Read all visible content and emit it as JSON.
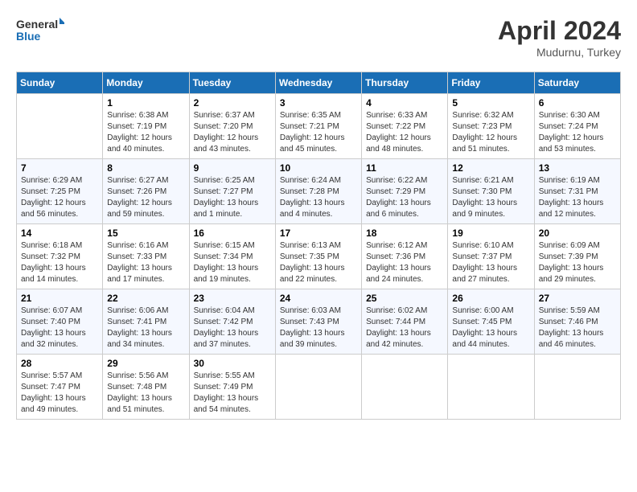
{
  "header": {
    "logo_line1": "General",
    "logo_line2": "Blue",
    "month": "April 2024",
    "location": "Mudurnu, Turkey"
  },
  "weekdays": [
    "Sunday",
    "Monday",
    "Tuesday",
    "Wednesday",
    "Thursday",
    "Friday",
    "Saturday"
  ],
  "weeks": [
    [
      {
        "day": "",
        "sunrise": "",
        "sunset": "",
        "daylight": ""
      },
      {
        "day": "1",
        "sunrise": "Sunrise: 6:38 AM",
        "sunset": "Sunset: 7:19 PM",
        "daylight": "Daylight: 12 hours and 40 minutes."
      },
      {
        "day": "2",
        "sunrise": "Sunrise: 6:37 AM",
        "sunset": "Sunset: 7:20 PM",
        "daylight": "Daylight: 12 hours and 43 minutes."
      },
      {
        "day": "3",
        "sunrise": "Sunrise: 6:35 AM",
        "sunset": "Sunset: 7:21 PM",
        "daylight": "Daylight: 12 hours and 45 minutes."
      },
      {
        "day": "4",
        "sunrise": "Sunrise: 6:33 AM",
        "sunset": "Sunset: 7:22 PM",
        "daylight": "Daylight: 12 hours and 48 minutes."
      },
      {
        "day": "5",
        "sunrise": "Sunrise: 6:32 AM",
        "sunset": "Sunset: 7:23 PM",
        "daylight": "Daylight: 12 hours and 51 minutes."
      },
      {
        "day": "6",
        "sunrise": "Sunrise: 6:30 AM",
        "sunset": "Sunset: 7:24 PM",
        "daylight": "Daylight: 12 hours and 53 minutes."
      }
    ],
    [
      {
        "day": "7",
        "sunrise": "Sunrise: 6:29 AM",
        "sunset": "Sunset: 7:25 PM",
        "daylight": "Daylight: 12 hours and 56 minutes."
      },
      {
        "day": "8",
        "sunrise": "Sunrise: 6:27 AM",
        "sunset": "Sunset: 7:26 PM",
        "daylight": "Daylight: 12 hours and 59 minutes."
      },
      {
        "day": "9",
        "sunrise": "Sunrise: 6:25 AM",
        "sunset": "Sunset: 7:27 PM",
        "daylight": "Daylight: 13 hours and 1 minute."
      },
      {
        "day": "10",
        "sunrise": "Sunrise: 6:24 AM",
        "sunset": "Sunset: 7:28 PM",
        "daylight": "Daylight: 13 hours and 4 minutes."
      },
      {
        "day": "11",
        "sunrise": "Sunrise: 6:22 AM",
        "sunset": "Sunset: 7:29 PM",
        "daylight": "Daylight: 13 hours and 6 minutes."
      },
      {
        "day": "12",
        "sunrise": "Sunrise: 6:21 AM",
        "sunset": "Sunset: 7:30 PM",
        "daylight": "Daylight: 13 hours and 9 minutes."
      },
      {
        "day": "13",
        "sunrise": "Sunrise: 6:19 AM",
        "sunset": "Sunset: 7:31 PM",
        "daylight": "Daylight: 13 hours and 12 minutes."
      }
    ],
    [
      {
        "day": "14",
        "sunrise": "Sunrise: 6:18 AM",
        "sunset": "Sunset: 7:32 PM",
        "daylight": "Daylight: 13 hours and 14 minutes."
      },
      {
        "day": "15",
        "sunrise": "Sunrise: 6:16 AM",
        "sunset": "Sunset: 7:33 PM",
        "daylight": "Daylight: 13 hours and 17 minutes."
      },
      {
        "day": "16",
        "sunrise": "Sunrise: 6:15 AM",
        "sunset": "Sunset: 7:34 PM",
        "daylight": "Daylight: 13 hours and 19 minutes."
      },
      {
        "day": "17",
        "sunrise": "Sunrise: 6:13 AM",
        "sunset": "Sunset: 7:35 PM",
        "daylight": "Daylight: 13 hours and 22 minutes."
      },
      {
        "day": "18",
        "sunrise": "Sunrise: 6:12 AM",
        "sunset": "Sunset: 7:36 PM",
        "daylight": "Daylight: 13 hours and 24 minutes."
      },
      {
        "day": "19",
        "sunrise": "Sunrise: 6:10 AM",
        "sunset": "Sunset: 7:37 PM",
        "daylight": "Daylight: 13 hours and 27 minutes."
      },
      {
        "day": "20",
        "sunrise": "Sunrise: 6:09 AM",
        "sunset": "Sunset: 7:39 PM",
        "daylight": "Daylight: 13 hours and 29 minutes."
      }
    ],
    [
      {
        "day": "21",
        "sunrise": "Sunrise: 6:07 AM",
        "sunset": "Sunset: 7:40 PM",
        "daylight": "Daylight: 13 hours and 32 minutes."
      },
      {
        "day": "22",
        "sunrise": "Sunrise: 6:06 AM",
        "sunset": "Sunset: 7:41 PM",
        "daylight": "Daylight: 13 hours and 34 minutes."
      },
      {
        "day": "23",
        "sunrise": "Sunrise: 6:04 AM",
        "sunset": "Sunset: 7:42 PM",
        "daylight": "Daylight: 13 hours and 37 minutes."
      },
      {
        "day": "24",
        "sunrise": "Sunrise: 6:03 AM",
        "sunset": "Sunset: 7:43 PM",
        "daylight": "Daylight: 13 hours and 39 minutes."
      },
      {
        "day": "25",
        "sunrise": "Sunrise: 6:02 AM",
        "sunset": "Sunset: 7:44 PM",
        "daylight": "Daylight: 13 hours and 42 minutes."
      },
      {
        "day": "26",
        "sunrise": "Sunrise: 6:00 AM",
        "sunset": "Sunset: 7:45 PM",
        "daylight": "Daylight: 13 hours and 44 minutes."
      },
      {
        "day": "27",
        "sunrise": "Sunrise: 5:59 AM",
        "sunset": "Sunset: 7:46 PM",
        "daylight": "Daylight: 13 hours and 46 minutes."
      }
    ],
    [
      {
        "day": "28",
        "sunrise": "Sunrise: 5:57 AM",
        "sunset": "Sunset: 7:47 PM",
        "daylight": "Daylight: 13 hours and 49 minutes."
      },
      {
        "day": "29",
        "sunrise": "Sunrise: 5:56 AM",
        "sunset": "Sunset: 7:48 PM",
        "daylight": "Daylight: 13 hours and 51 minutes."
      },
      {
        "day": "30",
        "sunrise": "Sunrise: 5:55 AM",
        "sunset": "Sunset: 7:49 PM",
        "daylight": "Daylight: 13 hours and 54 minutes."
      },
      {
        "day": "",
        "sunrise": "",
        "sunset": "",
        "daylight": ""
      },
      {
        "day": "",
        "sunrise": "",
        "sunset": "",
        "daylight": ""
      },
      {
        "day": "",
        "sunrise": "",
        "sunset": "",
        "daylight": ""
      },
      {
        "day": "",
        "sunrise": "",
        "sunset": "",
        "daylight": ""
      }
    ]
  ]
}
